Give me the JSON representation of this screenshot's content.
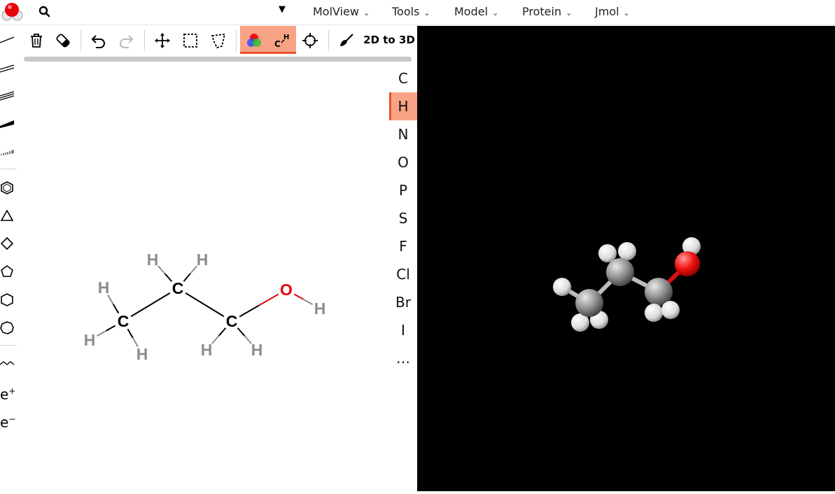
{
  "search": {
    "placeholder": "",
    "value": ""
  },
  "menus": [
    {
      "label": "MolView"
    },
    {
      "label": "Tools"
    },
    {
      "label": "Model"
    },
    {
      "label": "Protein"
    },
    {
      "label": "Jmol"
    }
  ],
  "toolbar": {
    "convert_label": "2D to 3D",
    "active_tools": [
      "color-mode",
      "show-hydrogens"
    ]
  },
  "left_toolbar": {
    "charge_plus": "e",
    "charge_plus_sup": "+",
    "charge_minus": "e",
    "charge_minus_sup": "−"
  },
  "elements": {
    "items": [
      "C",
      "H",
      "N",
      "O",
      "P",
      "S",
      "F",
      "Cl",
      "Br",
      "I",
      "…"
    ],
    "selected": "H"
  },
  "molecule2d": {
    "atoms": [
      {
        "id": "c1",
        "symbol": "C"
      },
      {
        "id": "c2",
        "symbol": "C"
      },
      {
        "id": "c3",
        "symbol": "C"
      },
      {
        "id": "o1",
        "symbol": "O"
      },
      {
        "id": "h1",
        "symbol": "H"
      },
      {
        "id": "h2",
        "symbol": "H"
      },
      {
        "id": "h3",
        "symbol": "H"
      },
      {
        "id": "h4",
        "symbol": "H"
      },
      {
        "id": "h5",
        "symbol": "H"
      },
      {
        "id": "h6",
        "symbol": "H"
      },
      {
        "id": "h7",
        "symbol": "H"
      },
      {
        "id": "h8",
        "symbol": "H"
      }
    ]
  },
  "colors": {
    "accent": "#f8a385",
    "accent_border": "#e8532a",
    "carbon": "#000000",
    "oxygen": "#e8000b",
    "hydrogen": "#8c8c8c",
    "viewer_bg": "#000000"
  }
}
